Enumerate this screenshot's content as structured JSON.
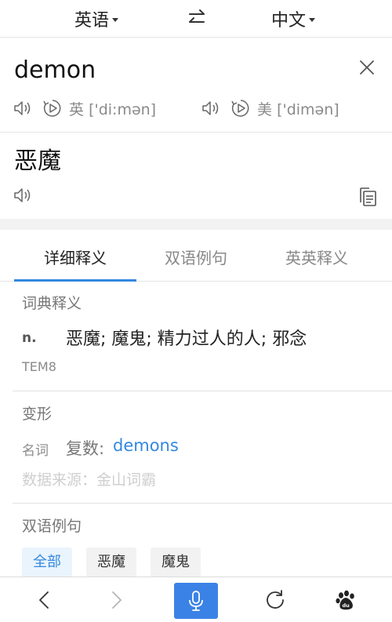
{
  "lang_bar": {
    "source_lang": "英语",
    "target_lang": "中文"
  },
  "source": {
    "word": "demon",
    "pronunciations": [
      {
        "region": "英",
        "phonetic": "['di:mən]"
      },
      {
        "region": "美",
        "phonetic": "['dimən]"
      }
    ]
  },
  "translation": {
    "word": "恶魔"
  },
  "tabs": [
    {
      "label": "详细释义",
      "active": true
    },
    {
      "label": "双语例句",
      "active": false
    },
    {
      "label": "英英释义",
      "active": false
    }
  ],
  "dictionary": {
    "title": "词典释义",
    "pos": "n.",
    "meaning": "恶魔; 魔鬼; 精力过人的人; 邪念",
    "tag": "TEM8"
  },
  "morphology": {
    "title": "变形",
    "label": "名词",
    "kind": "复数:",
    "value": "demons",
    "source": "数据来源：金山词霸"
  },
  "examples": {
    "title": "双语例句",
    "chips": [
      {
        "label": "全部",
        "active": true
      },
      {
        "label": "恶魔",
        "active": false
      },
      {
        "label": "魔鬼",
        "active": false
      }
    ]
  },
  "bottom_nav": [
    "back-icon",
    "forward-icon",
    "microphone-icon",
    "refresh-icon",
    "baidu-paw-icon"
  ],
  "colors": {
    "accent": "#3388e0",
    "mic_button": "#3b82e6"
  }
}
